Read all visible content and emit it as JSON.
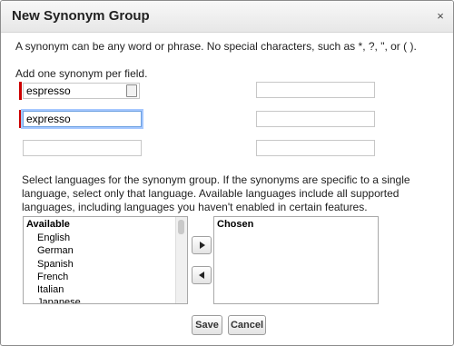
{
  "dialog": {
    "title": "New Synonym Group",
    "close_label": "×"
  },
  "intro_text": "A synonym can be any word or phrase. No special characters, such as *, ?, \", or ( ).",
  "field_hint": "Add one synonym per field.",
  "synonyms": {
    "field1": "espresso",
    "field2": "expresso",
    "field3": "",
    "field4": "",
    "field5": "",
    "field6": ""
  },
  "languages_text": "Select languages for the synonym group. If the synonyms are specific to a single language, select only that language. Available languages include all supported languages, including languages you haven't enabled in certain features.",
  "available": {
    "header": "Available",
    "items": [
      "English",
      "German",
      "Spanish",
      "French",
      "Italian",
      "Japanese"
    ]
  },
  "chosen": {
    "header": "Chosen"
  },
  "buttons": {
    "save": "Save",
    "cancel": "Cancel"
  },
  "colors": {
    "required_marker": "#cc0000",
    "focus_ring": "#a6c8ff"
  }
}
